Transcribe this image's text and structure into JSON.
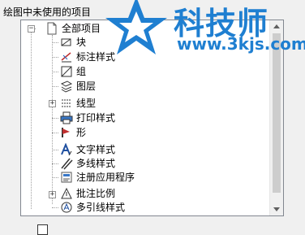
{
  "header_label": "绘图中未使用的项目",
  "tree": {
    "root": "全部项目",
    "items": [
      {
        "label": "块",
        "icon": "block-icon"
      },
      {
        "label": "标注样式",
        "icon": "dimstyle-icon"
      },
      {
        "label": "组",
        "icon": "group-icon"
      },
      {
        "label": "图层",
        "icon": "layer-icon"
      },
      {
        "label": "线型",
        "icon": "linetype-icon"
      },
      {
        "label": "打印样式",
        "icon": "plotstyle-icon"
      },
      {
        "label": "形",
        "icon": "shape-icon"
      },
      {
        "label": "文字样式",
        "icon": "textstyle-icon"
      },
      {
        "label": "多线样式",
        "icon": "mlinestyle-icon"
      },
      {
        "label": "注册应用程序",
        "icon": "regapp-icon"
      },
      {
        "label": "批注比例",
        "icon": "annoscale-icon"
      },
      {
        "label": "多引线样式",
        "icon": "mleaderstyle-icon"
      }
    ]
  },
  "watermark": {
    "title": "科技师",
    "url": "www.3kjs.com"
  },
  "colors": {
    "accent": "#1f7fd1"
  }
}
